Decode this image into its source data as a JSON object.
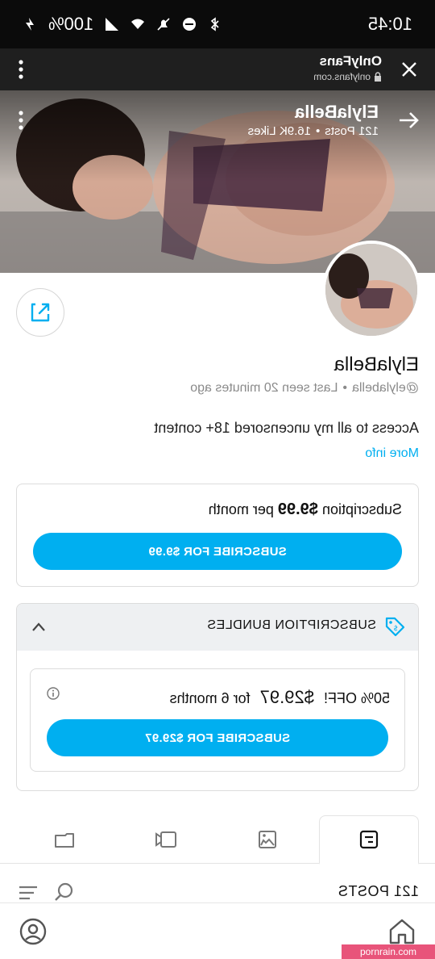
{
  "status_bar": {
    "time": "10:45",
    "battery": "100%"
  },
  "browser": {
    "title": "OnlyFans",
    "url": "onlyfans.com"
  },
  "cover": {
    "name": "ElylaBella",
    "posts": "121 Posts",
    "likes": "16.9K Likes",
    "separator": "•"
  },
  "profile": {
    "name": "ElylaBella",
    "handle": "@elylabella",
    "separator": "•",
    "last_seen": "Last seen 20 minutes ago",
    "bio": "Access to all my uncensored 18+ content",
    "more_info": "More info"
  },
  "subscription": {
    "label": "Subscription",
    "price": "$9.99",
    "period": "per month",
    "button": "SUBSCRIBE FOR $9.99"
  },
  "bundles": {
    "title": "SUBSCRIPTION BUNDLES",
    "offer_discount": "50% OFF!",
    "offer_price": "$29.97",
    "offer_period": "for 6 months",
    "button": "SUBSCRIBE FOR $29.97"
  },
  "posts": {
    "label": "121 POSTS"
  },
  "watermark": "pornrain.com",
  "colors": {
    "accent": "#00aff0",
    "status_bar": "#0b0b0b",
    "browser_bar": "#1f1f1f"
  },
  "icons": {
    "tabs": [
      "posts-tab-icon",
      "photos-tab-icon",
      "videos-tab-icon",
      "archive-tab-icon"
    ],
    "nav": [
      "home-icon",
      "profile-icon"
    ]
  }
}
